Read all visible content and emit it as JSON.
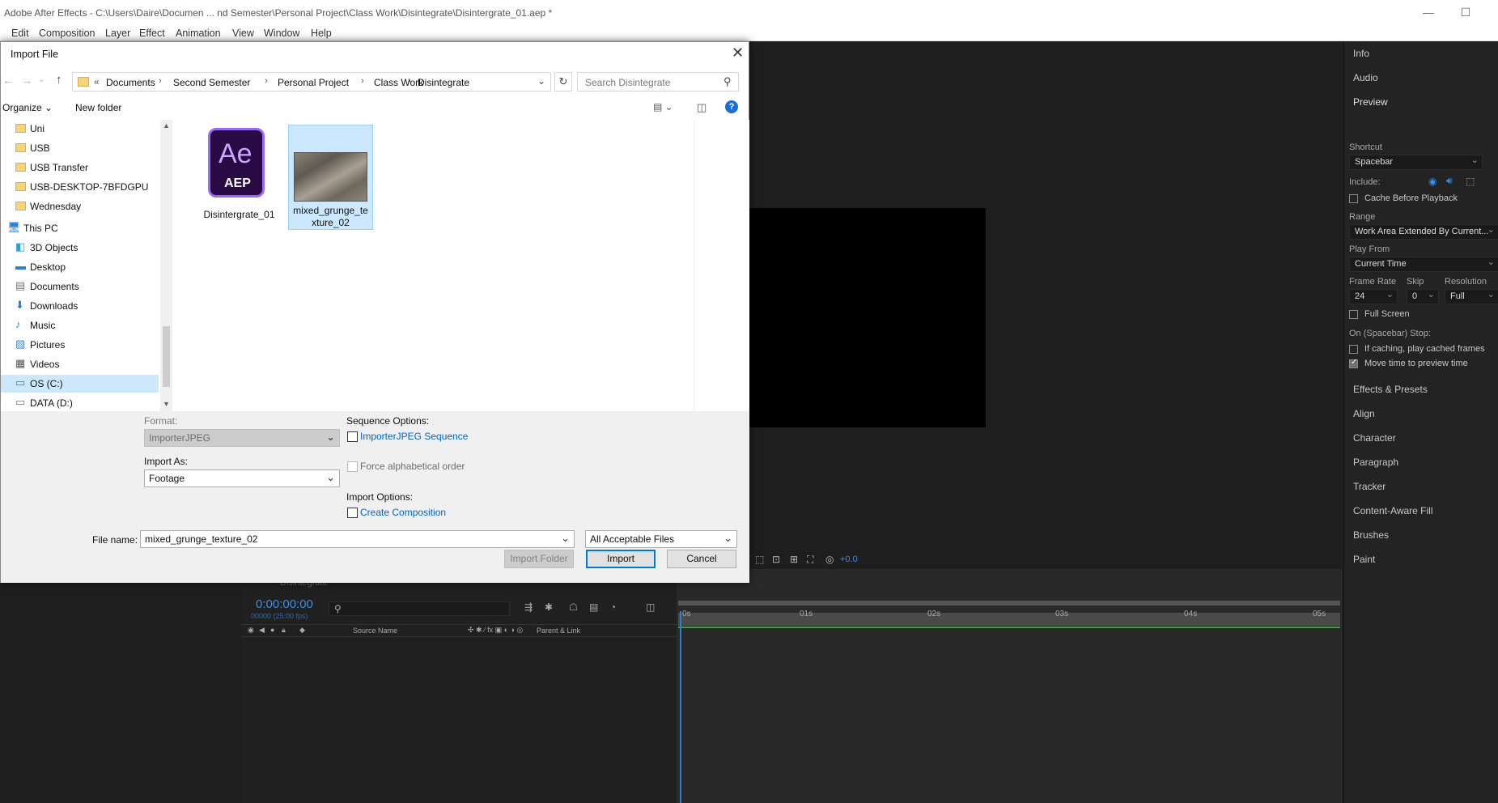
{
  "app": {
    "title": "Adobe After Effects - C:\\Users\\Daire\\Documen ... nd Semester\\Personal Project\\Class Work\\Disintegrate\\Disintergrate_01.aep *"
  },
  "menu": [
    "Edit",
    "Composition",
    "Layer",
    "Effect",
    "Animation",
    "View",
    "Window",
    "Help"
  ],
  "dialog": {
    "title": "Import File",
    "breadcrumb": [
      "Documents",
      "Second Semester",
      "Personal Project",
      "Class Work",
      "Disintegrate"
    ],
    "search_placeholder": "Search Disintegrate",
    "organize": "Organize",
    "new_folder": "New folder",
    "nav_items": [
      {
        "label": "Uni",
        "icon": "folder-icon"
      },
      {
        "label": "USB",
        "icon": "folder-icon"
      },
      {
        "label": "USB Transfer",
        "icon": "folder-icon"
      },
      {
        "label": "USB-DESKTOP-7BFDGPU",
        "icon": "folder-icon"
      },
      {
        "label": "Wednesday",
        "icon": "folder-icon"
      },
      {
        "label": "This PC",
        "icon": "computer-icon"
      },
      {
        "label": "3D Objects",
        "icon": "cube-icon"
      },
      {
        "label": "Desktop",
        "icon": "desktop-icon"
      },
      {
        "label": "Documents",
        "icon": "document-icon"
      },
      {
        "label": "Downloads",
        "icon": "download-icon"
      },
      {
        "label": "Music",
        "icon": "music-icon"
      },
      {
        "label": "Pictures",
        "icon": "picture-icon"
      },
      {
        "label": "Videos",
        "icon": "video-icon"
      },
      {
        "label": "OS (C:)",
        "icon": "drive-icon"
      },
      {
        "label": "DATA (D:)",
        "icon": "drive-icon"
      }
    ],
    "files": [
      {
        "name": "Disintergrate_01",
        "icon_top": "Ae",
        "icon_bottom": "AEP"
      },
      {
        "name_line1": "mixed_grunge_te",
        "name_line2": "xture_02"
      }
    ],
    "format_label": "Format:",
    "format_value": "ImporterJPEG",
    "import_as_label": "Import As:",
    "import_as_value": "Footage",
    "sequence_options_label": "Sequence Options:",
    "sequence_checkbox": "ImporterJPEG Sequence",
    "force_alpha": "Force alphabetical order",
    "import_options_label": "Import Options:",
    "create_comp": "Create Composition",
    "file_name_label": "File name:",
    "file_name_value": "mixed_grunge_texture_02",
    "file_type": "All Acceptable Files",
    "import_folder": "Import Folder",
    "import": "Import",
    "cancel": "Cancel"
  },
  "right_panel": {
    "sections_top": [
      "Info",
      "Audio",
      "Preview"
    ],
    "shortcut_label": "Shortcut",
    "shortcut_value": "Spacebar",
    "include_label": "Include:",
    "cache_before": "Cache Before Playback",
    "range_label": "Range",
    "range_value": "Work Area Extended By Current...",
    "play_from_label": "Play From",
    "play_from_value": "Current Time",
    "frame_rate_label": "Frame Rate",
    "skip_label": "Skip",
    "resolution_label": "Resolution",
    "frame_rate_value": "24",
    "skip_value": "0",
    "resolution_value": "Full",
    "full_screen": "Full Screen",
    "on_stop_label": "On (Spacebar) Stop:",
    "if_caching": "If caching, play cached frames",
    "move_time": "Move time to preview time",
    "sections_bottom": [
      "Effects & Presets",
      "Align",
      "Character",
      "Paragraph",
      "Tracker",
      "Content-Aware Fill",
      "Brushes",
      "Paint"
    ]
  },
  "viewer": {
    "exposure": "+0.0"
  },
  "timeline": {
    "comp_name": "Disintegrate",
    "timecode": "0:00:00:00",
    "frame_info": "00000 (25.00 fps)",
    "source_name": "Source Name",
    "parent_link": "Parent & Link",
    "ruler": [
      "0s",
      "01s",
      "02s",
      "03s",
      "04s",
      "05s"
    ]
  }
}
